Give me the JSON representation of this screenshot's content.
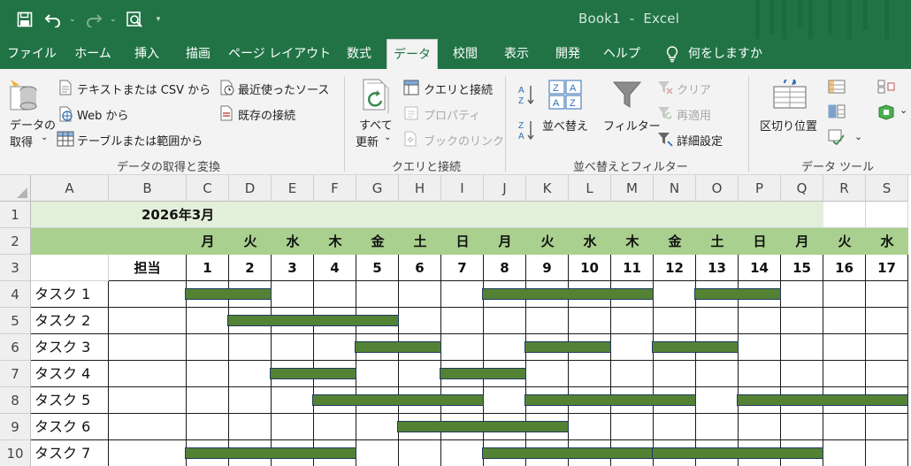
{
  "app": {
    "title": "Book1  -  Excel",
    "colors": {
      "brand": "#217346",
      "header_band": "#a9d08e",
      "title_band": "#e2efda",
      "bar_fill": "#548235",
      "bar_border": "#1f3a5f"
    }
  },
  "qat": {
    "icons": [
      "save-icon",
      "undo-icon",
      "redo-icon",
      "print-preview-icon",
      "customize-qat-icon"
    ]
  },
  "tabs": [
    "ファイル",
    "ホーム",
    "挿入",
    "描画",
    "ページ レイアウト",
    "数式",
    "データ",
    "校閲",
    "表示",
    "開発",
    "ヘルプ",
    "何をしますか"
  ],
  "active_tab": "データ",
  "ribbon": {
    "get_data_line1": "データの",
    "get_data_line2": "取得",
    "from_text_csv": "テキストまたは CSV から",
    "from_web": "Web から",
    "from_table": "テーブルまたは範囲から",
    "recent_sources": "最近使ったソース",
    "existing_connections": "既存の接続",
    "group_get_data": "データの取得と変換",
    "refresh_all_line1": "すべて",
    "refresh_all_line2": "更新",
    "queries_connections": "クエリと接続",
    "properties": "プロパティ",
    "edit_links": "ブックのリンク",
    "group_queries": "クエリと接続",
    "sort": "並べ替え",
    "filter": "フィルター",
    "clear": "クリア",
    "reapply": "再適用",
    "advanced": "詳細設定",
    "group_sort_filter": "並べ替えとフィルター",
    "text_to_columns": "区切り位置",
    "group_data_tools": "データ ツール"
  },
  "sheet": {
    "columns": [
      "A",
      "B",
      "C",
      "D",
      "E",
      "F",
      "G",
      "H",
      "I",
      "J",
      "K",
      "L",
      "M",
      "N",
      "O",
      "P",
      "Q",
      "R",
      "S"
    ],
    "rows": [
      "1",
      "2",
      "3",
      "4",
      "5",
      "6",
      "7",
      "8",
      "9",
      "10"
    ],
    "title": "2026年3月",
    "weekdays": [
      "月",
      "火",
      "水",
      "木",
      "金",
      "土",
      "日",
      "月",
      "火",
      "水",
      "木",
      "金",
      "土",
      "日",
      "月",
      "火",
      "水"
    ],
    "assignee_header": "担当",
    "days": [
      "1",
      "2",
      "3",
      "4",
      "5",
      "6",
      "7",
      "8",
      "9",
      "10",
      "11",
      "12",
      "13",
      "14",
      "15",
      "16",
      "17"
    ],
    "tasks": [
      {
        "name": "タスク 1",
        "bars": [
          [
            1,
            2
          ],
          [
            8,
            11
          ],
          [
            13,
            14
          ]
        ]
      },
      {
        "name": "タスク 2",
        "bars": [
          [
            2,
            5
          ]
        ]
      },
      {
        "name": "タスク 3",
        "bars": [
          [
            5,
            6
          ],
          [
            9,
            10
          ],
          [
            12,
            13
          ]
        ]
      },
      {
        "name": "タスク 4",
        "bars": [
          [
            3,
            4
          ],
          [
            7,
            8
          ]
        ]
      },
      {
        "name": "タスク 5",
        "bars": [
          [
            4,
            7
          ],
          [
            9,
            12
          ],
          [
            14,
            17
          ]
        ]
      },
      {
        "name": "タスク 6",
        "bars": [
          [
            6,
            9
          ]
        ]
      },
      {
        "name": "タスク 7",
        "bars": [
          [
            1,
            4
          ],
          [
            8,
            11
          ],
          [
            12,
            15
          ]
        ]
      }
    ]
  }
}
